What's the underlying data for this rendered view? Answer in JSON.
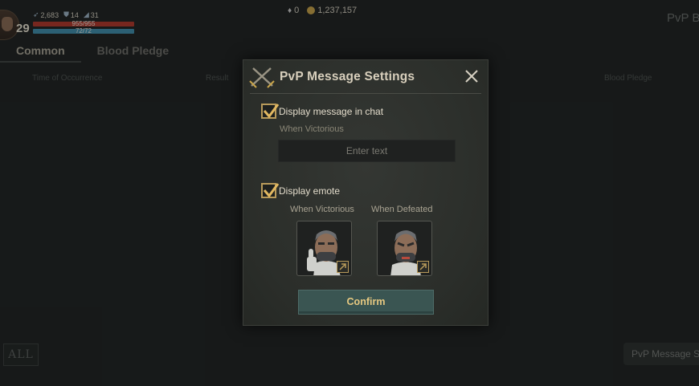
{
  "hud": {
    "level": "29",
    "stat_1": "2,683",
    "stat_2": "14",
    "stat_3": "31",
    "hp": "955/955",
    "mp": "72/72"
  },
  "currency": {
    "item_count": "0",
    "gold": "1,237,157"
  },
  "background": {
    "top_right_title": "PvP B",
    "tabs": [
      "Common",
      "Blood Pledge"
    ],
    "columns": {
      "time": "Time of Occurrence",
      "result": "Result",
      "pledge": "Blood Pledge"
    },
    "all_button": "ALL",
    "bottom_right_button": "PvP Message S"
  },
  "dialog": {
    "title": "PvP Message Settings",
    "chat_checkbox": {
      "label": "Display message in chat",
      "checked": true
    },
    "victorious_label": "When Victorious",
    "victory_message": {
      "value": "",
      "placeholder": "Enter text"
    },
    "emote_checkbox": {
      "label": "Display emote",
      "checked": true
    },
    "emote_victorious_label": "When Victorious",
    "emote_defeated_label": "When Defeated",
    "confirm_label": "Confirm"
  },
  "colors": {
    "accent_gold": "#b89a5a",
    "confirm_bg": "#3a5552",
    "hp": "#b2382c",
    "mp": "#3f8fae"
  }
}
